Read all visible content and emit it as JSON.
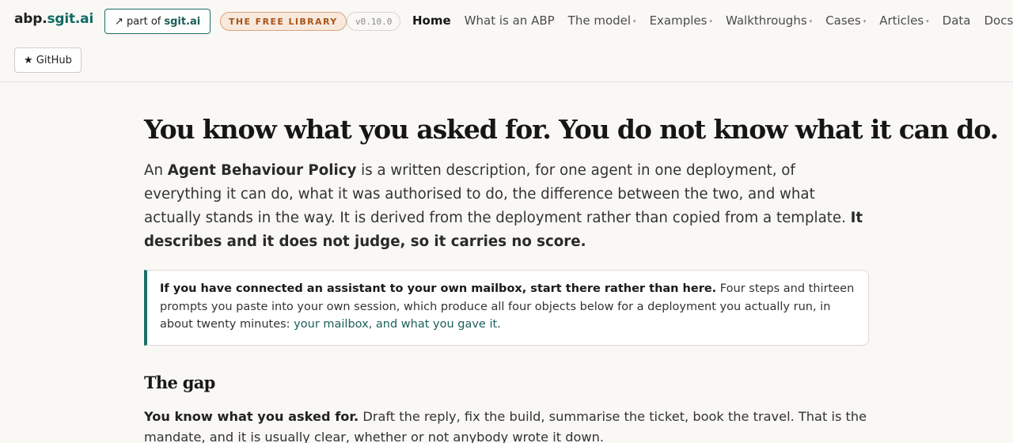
{
  "header": {
    "brand_prefix": "abp.",
    "brand_accent": "sgit.ai",
    "part_of_prefix": "↗ part of",
    "part_of_site": "sgit.ai",
    "free_library": "THE FREE LIBRARY",
    "version": "v0.10.0",
    "github": "★ GitHub",
    "nav": [
      {
        "label": "Home",
        "active": true,
        "dropdown": false
      },
      {
        "label": "What is an ABP",
        "active": false,
        "dropdown": false
      },
      {
        "label": "The model",
        "active": false,
        "dropdown": true
      },
      {
        "label": "Examples",
        "active": false,
        "dropdown": true
      },
      {
        "label": "Walkthroughs",
        "active": false,
        "dropdown": true
      },
      {
        "label": "Cases",
        "active": false,
        "dropdown": true
      },
      {
        "label": "Articles",
        "active": false,
        "dropdown": true
      },
      {
        "label": "Data",
        "active": false,
        "dropdown": false
      },
      {
        "label": "Docs",
        "active": false,
        "dropdown": true
      }
    ],
    "caret_glyph": "▾"
  },
  "main": {
    "title": "You know what you asked for. You do not know what it can do.",
    "intro": {
      "lead": "An ",
      "term": "Agent Behaviour Policy",
      "body": " is a written description, for one agent in one deployment, of everything it can do, what it was authorised to do, the difference between the two, and what actually stands in the way. It is derived from the deployment rather than copied from a template. ",
      "emphasis": "It describes and it does not judge, so it carries no score."
    },
    "callout": {
      "bold": "If you have connected an assistant to your own mailbox, start there rather than here.",
      "body": " Four steps and thirteen prompts you paste into your own session, which produce all four objects below for a deployment you actually run, in about twenty minutes: ",
      "link": "your mailbox, and what you gave it",
      "tail": "."
    },
    "section_title": "The gap",
    "gap": {
      "bold": "You know what you asked for.",
      "body": " Draft the reply, fix the build, summarise the ticket, book the travel. That is the mandate, and it is usually clear, whether or not anybody wrote it down."
    }
  },
  "colors": {
    "accent": "#0f6b63",
    "badge_text": "#a8541a",
    "background": "#f9f8f5"
  }
}
